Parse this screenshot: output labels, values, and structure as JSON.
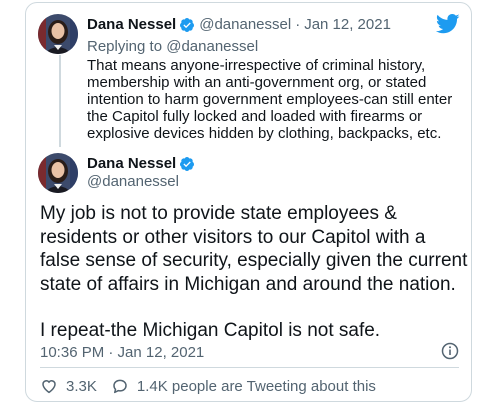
{
  "reply_tweet": {
    "author_name": "Dana Nessel",
    "author_handle": "@dananessel",
    "separator": "·",
    "date": "Jan 12, 2021",
    "replying_label": "Replying to",
    "replying_handle": "@dananessel",
    "text": "That means anyone-irrespective of criminal history, membership with an anti-government org, or stated intention to harm government employees-can still enter the Capitol fully locked and loaded with firearms or explosive devices hidden by clothing, backpacks, etc."
  },
  "main_tweet": {
    "author_name": "Dana Nessel",
    "author_handle": "@dananessel",
    "paragraphs": [
      "My job is not to provide state employees & residents or other visitors to our Capitol with a false sense of security, especially given the current state of affairs in Michigan and around the nation.",
      "I repeat-the Michigan Capitol is not safe."
    ],
    "timestamp": "10:36 PM · Jan 12, 2021",
    "likes": "3.3K",
    "replies_label": "1.4K people are Tweeting about this"
  },
  "icons": {
    "logo": "twitter-bird-icon",
    "verified": "verified-badge-icon",
    "info": "info-icon",
    "like": "heart-icon",
    "reply": "comment-icon"
  },
  "colors": {
    "brand": "#1d9bf0",
    "text": "#0f1419",
    "muted": "#536471",
    "border": "#cfd9de"
  }
}
